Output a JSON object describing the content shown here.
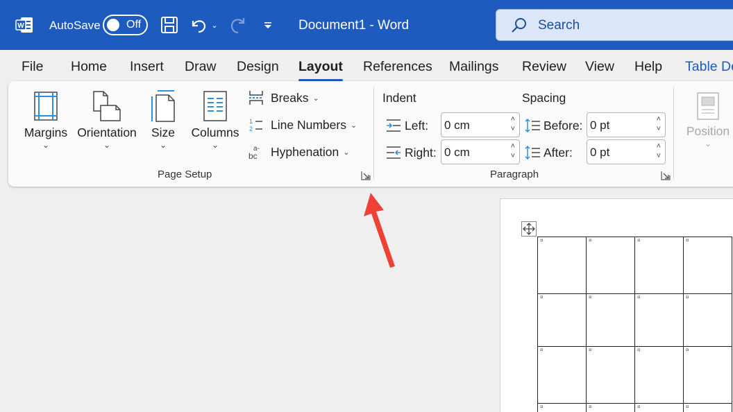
{
  "titlebar": {
    "autosave_label": "AutoSave",
    "autosave_state": "Off",
    "document_title": "Document1  -  Word",
    "search_placeholder": "Search",
    "brand_color": "#1e5bbf"
  },
  "tabs": [
    {
      "label": "File"
    },
    {
      "label": "Home"
    },
    {
      "label": "Insert"
    },
    {
      "label": "Draw"
    },
    {
      "label": "Design"
    },
    {
      "label": "Layout",
      "active": true
    },
    {
      "label": "References"
    },
    {
      "label": "Mailings"
    },
    {
      "label": "Review"
    },
    {
      "label": "View"
    },
    {
      "label": "Help"
    },
    {
      "label": "Table De",
      "contextual": true
    }
  ],
  "page_setup": {
    "group_label": "Page Setup",
    "margins": "Margins",
    "orientation": "Orientation",
    "size": "Size",
    "columns": "Columns",
    "breaks": "Breaks",
    "line_numbers": "Line Numbers",
    "hyphenation": "Hyphenation"
  },
  "paragraph": {
    "group_label": "Paragraph",
    "indent_header": "Indent",
    "spacing_header": "Spacing",
    "left_label": "Left:",
    "left_value": "0 cm",
    "right_label": "Right:",
    "right_value": "0 cm",
    "before_label": "Before:",
    "before_value": "0 pt",
    "after_label": "After:",
    "after_value": "0 pt"
  },
  "arrange": {
    "position": "Position"
  },
  "table_marker": "¤"
}
